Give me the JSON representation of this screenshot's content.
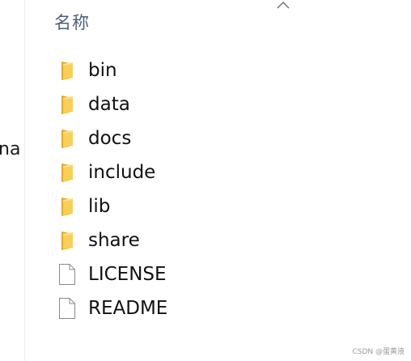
{
  "navigation": {
    "partial_label": "na"
  },
  "header": {
    "name_column": "名称",
    "sort_icon": "chevron-up-icon"
  },
  "files": [
    {
      "name": "bin",
      "type": "folder",
      "icon": "folder-icon"
    },
    {
      "name": "data",
      "type": "folder",
      "icon": "folder-icon"
    },
    {
      "name": "docs",
      "type": "folder",
      "icon": "folder-icon"
    },
    {
      "name": "include",
      "type": "folder",
      "icon": "folder-icon"
    },
    {
      "name": "lib",
      "type": "folder",
      "icon": "folder-icon"
    },
    {
      "name": "share",
      "type": "folder",
      "icon": "folder-icon"
    },
    {
      "name": "LICENSE",
      "type": "file",
      "icon": "document-icon"
    },
    {
      "name": "README",
      "type": "file",
      "icon": "document-icon"
    }
  ],
  "watermark": "CSDN @蛋黄液",
  "colors": {
    "folder_body": "#f8cf59",
    "folder_tab": "#e8a924",
    "document_border": "#8a8a8a",
    "header_text": "#4c607a"
  }
}
